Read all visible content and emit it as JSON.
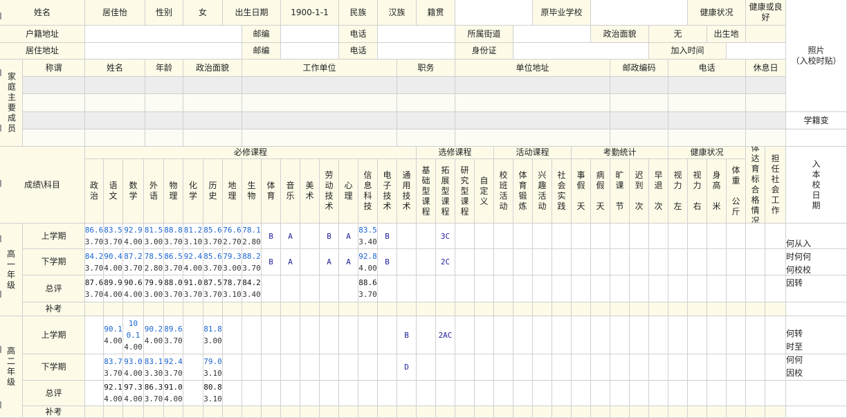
{
  "info": {
    "name_label": "姓名",
    "name": "居佳怡",
    "gender_label": "性别",
    "gender": "女",
    "birth_label": "出生日期",
    "birth": "1900-1-1",
    "ethnic_label": "民族",
    "ethnic": "汉族",
    "native_label": "籍贯",
    "school_label": "原毕业学校",
    "health_label": "健康状况",
    "health": "健康或良\n好",
    "hukou_label": "户籍地址",
    "postcode_label": "邮编",
    "phone_label": "电话",
    "street_label": "所属街道",
    "politics_label": "政治面貌",
    "politics": "无",
    "birthplace_label": "出生地",
    "residence_label": "居住地址",
    "idcard_label": "身份证",
    "join_label": "加入时间",
    "photo_label": "照片\n（入校时贴）"
  },
  "family": {
    "side_label": "家庭主要成员",
    "headers": [
      "称谓",
      "姓名",
      "年龄",
      "政治面貌",
      "工作单位",
      "职务",
      "单位地址",
      "邮政编码",
      "电话",
      "休息日"
    ],
    "edge_text": "学籍变"
  },
  "subjects": {
    "corner_label": "成绩\\科目",
    "groups": [
      "必修课程",
      "选修课程",
      "活动课程",
      "考勤统计",
      "健康状况"
    ],
    "columns": [
      "政\n治",
      "语\n文",
      "数\n学",
      "外\n语",
      "物\n理",
      "化\n学",
      "历\n史",
      "地\n理",
      "生\n物",
      "体\n育",
      "音\n乐",
      "美\n术",
      "劳\n动\n技\n术",
      "心\n理",
      "信\n息\n科\n技",
      "电\n子\n技\n术",
      "通\n用\n技\n术",
      "基\n础\n型\n课\n程",
      "拓\n展\n型\n课\n程",
      "研\n究\n型\n课\n程",
      "自\n定\n义",
      "校\n班\n活\n动",
      "体\n育\n锻\n炼",
      "兴\n趣\n活\n动",
      "社\n会\n实\n践",
      "事\n假\n\n天",
      "病\n假\n\n天",
      "旷\n课\n\n节",
      "迟\n到\n\n次",
      "早\n退\n\n次",
      "视\n力\n\n左",
      "视\n力\n\n右",
      "身\n高\n\n米",
      "体\n重\n\n公\n斤",
      "体\n达\n育\n标\n合\n格\n情\n况",
      "担\n任\n社\n会\n工\n作"
    ],
    "entry_label": "入\n本\n校\n日\n期"
  },
  "grades": {
    "g1_label": "高\n一\n年\n级",
    "g2_label": "高\n二\n年\n级",
    "rows": {
      "g1_first": {
        "label": "上学期",
        "cells": [
          "86.6|3.70",
          "83.5|3.70",
          "92.9|4.00",
          "81.5|3.00",
          "88.8|3.70",
          "81.2|3.10",
          "85.6|3.70",
          "76.6|2.70",
          "78.1|2.80",
          "B",
          "A",
          "",
          "B",
          "A",
          "83.5|3.40",
          "B",
          "",
          "",
          "3C"
        ]
      },
      "g1_second": {
        "label": "下学期",
        "cells": [
          "84.2|3.70",
          "90.4|4.00",
          "87.2|3.70",
          "78.5|2.80",
          "86.5|3.70",
          "92.4|4.00",
          "85.6|3.70",
          "79.3|3.00",
          "88.2|3.70",
          "B",
          "A",
          "",
          "A",
          "A",
          "92.8|4.00",
          "B",
          "",
          "",
          "2C"
        ]
      },
      "g1_total": {
        "label": "总评",
        "cells": [
          "87.6|3.70",
          "89.9|4.00",
          "90.6|4.00",
          "79.9|3.00",
          "88.0|3.70",
          "91.0|3.70",
          "87.5|3.70",
          "78.7|3.10",
          "84.2|3.40",
          "",
          "",
          "",
          "",
          "",
          "88.6|3.70"
        ]
      },
      "g1_makeup": {
        "label": "补考"
      },
      "g2_first": {
        "label": "上学期",
        "cells": [
          "",
          "90.1|4.00",
          "100.1|4.00",
          "90.2|4.00",
          "89.6|3.70",
          "",
          "81.8|3.00",
          "",
          "",
          "",
          "",
          "",
          "",
          "",
          "",
          "",
          "B",
          "",
          "2AC"
        ]
      },
      "g2_second": {
        "label": "下学期",
        "cells": [
          "",
          "83.7|3.70",
          "93.0|4.00",
          "83.1|3.30",
          "92.4|3.70",
          "",
          "79.0|3.10",
          "",
          "",
          "",
          "",
          "",
          "",
          "",
          "",
          "",
          "D"
        ]
      },
      "g2_total": {
        "label": "总评",
        "cells": [
          "",
          "92.1|4.00",
          "97.3|4.00",
          "86.3|3.70",
          "91.0|4.00",
          "",
          "80.8|3.10"
        ]
      },
      "g2_makeup": {
        "label": "补考"
      }
    },
    "side_note_1": "何从入\n时何何\n何校校\n因转",
    "side_note_2": "何转\n时至\n何何\n因校"
  }
}
